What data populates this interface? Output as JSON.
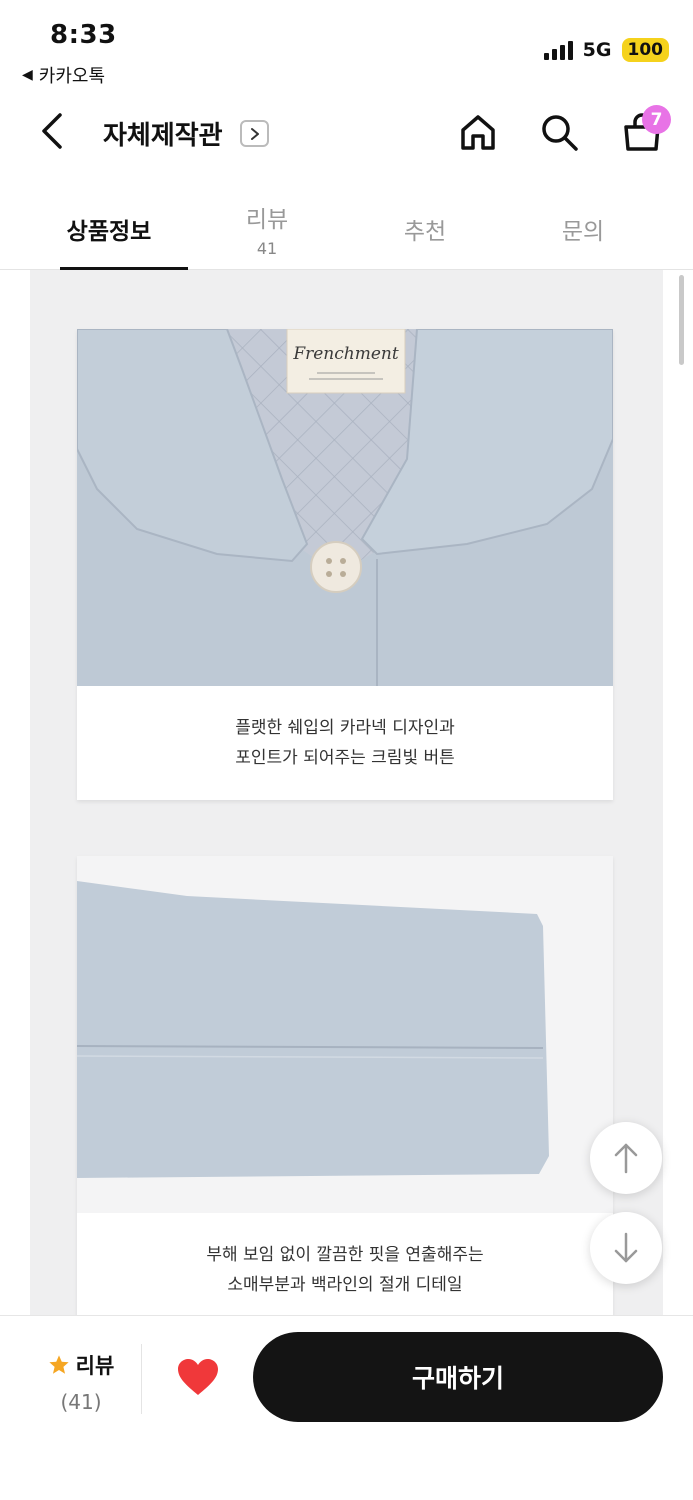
{
  "status_bar": {
    "time": "8:33",
    "back_app": "카카오톡",
    "network": "5G",
    "battery": "100"
  },
  "header": {
    "title": "자체제작관",
    "cart_count": "7"
  },
  "tabs": [
    {
      "label": "상품정보",
      "count": "",
      "active": true
    },
    {
      "label": "리뷰",
      "count": "41",
      "active": false
    },
    {
      "label": "추천",
      "count": "",
      "active": false
    },
    {
      "label": "문의",
      "count": "",
      "active": false
    }
  ],
  "cards": [
    {
      "image_label": "Frenchment",
      "caption_line1": "플랫한 쉐입의 카라넥 디자인과",
      "caption_line2": "포인트가 되어주는 크림빛 버튼"
    },
    {
      "caption_line1": "부해 보임 없이 깔끔한 핏을 연출해주는",
      "caption_line2": "소매부분과 백라인의 절개 디테일"
    }
  ],
  "bottom_bar": {
    "review_label": "리뷰",
    "review_count": "(41)",
    "buy_label": "구매하기"
  },
  "colors": {
    "badge": "#e873e6",
    "battery": "#f5d21c",
    "heart": "#f0383a",
    "star": "#f5a623",
    "buy_button": "#141414"
  }
}
